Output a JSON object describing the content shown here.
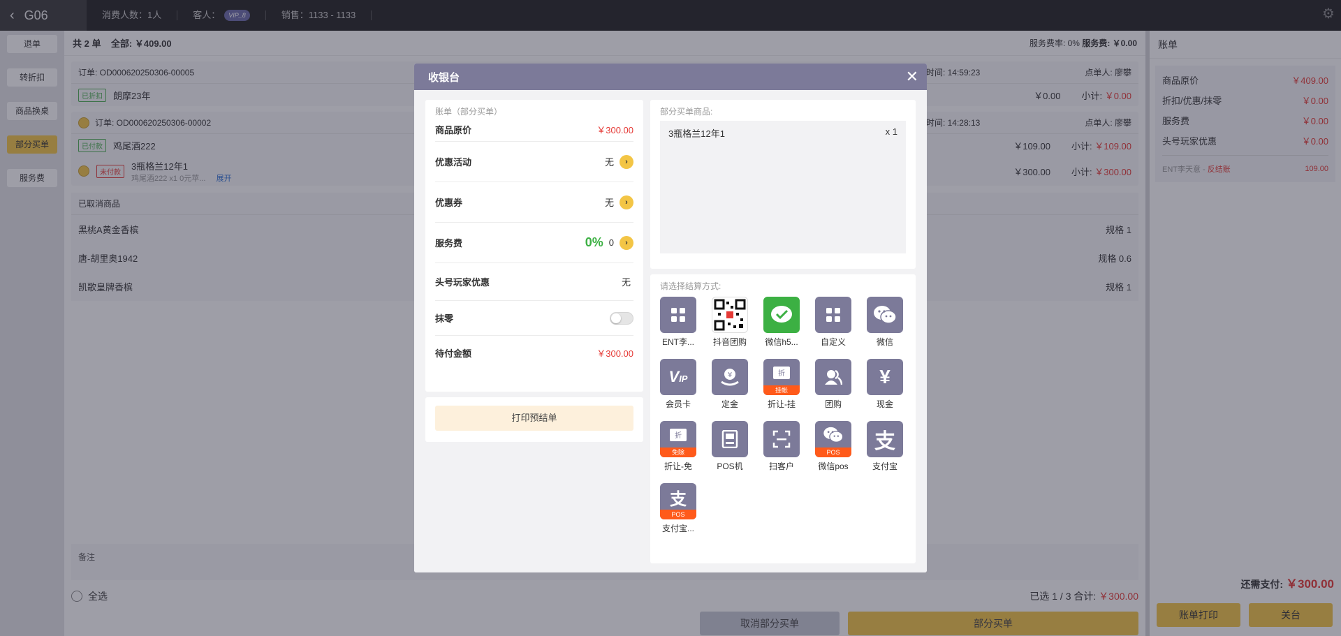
{
  "topbar": {
    "room": "G06",
    "consumers": "消费人数：1人",
    "guest_label": "客人：",
    "vip": "VIP_8",
    "sales": "销售：1133 - 1133"
  },
  "leftnav": [
    {
      "label": "退单",
      "active": false
    },
    {
      "label": "转折扣",
      "active": false
    },
    {
      "label": "商品换桌",
      "active": false
    },
    {
      "label": "部分买单",
      "active": true
    },
    {
      "label": "服务费",
      "active": false
    }
  ],
  "main": {
    "count": "共 2 单",
    "total": "全部: ￥409.00",
    "service_rate_label": "服务费率: 0%",
    "service_fee_label": "服务费: ￥0.00",
    "orders": [
      {
        "id": "订单: OD000620250306-00005",
        "time": "时间: 14:59:23",
        "orderer": "点单人: 廖攀",
        "items": [
          {
            "tag": "已折扣",
            "name": "朗摩23年",
            "price": "￥0.00",
            "subtotal_label": "小计:",
            "subtotal": "￥0.00"
          }
        ]
      },
      {
        "id": "订单: OD000620250306-00002",
        "time": "时间: 14:28:13",
        "orderer": "点单人: 廖攀",
        "items": [
          {
            "tag": "已付款",
            "name": "鸡尾酒222",
            "price": "￥109.00",
            "subtotal_label": "小计:",
            "subtotal": "￥109.00"
          },
          {
            "tag": "未付款",
            "name": "3瓶格兰12年1",
            "sub": "鸡尾酒222 x1   0元苹...",
            "expand": "展开",
            "price": "￥300.00",
            "subtotal_label": "小计:",
            "subtotal": "￥300.00"
          }
        ]
      }
    ],
    "cancelled_title": "已取消商品",
    "cancelled": [
      {
        "name": "黑桃A黄金香槟",
        "spec": "规格 1"
      },
      {
        "name": "唐-胡里奥1942",
        "spec": "规格 0.6"
      },
      {
        "name": "凯歌皇牌香槟",
        "spec": "规格 1"
      }
    ],
    "remark_label": "备注",
    "select_all": "全选",
    "selected_summary": "已选 1 / 3  合计:",
    "selected_total": "￥300.00",
    "cancel_partial": "取消部分买单",
    "partial_pay": "部分买单"
  },
  "bill_panel": {
    "title": "账单",
    "rows": [
      {
        "label": "商品原价",
        "value": "￥409.00"
      },
      {
        "label": "折扣/优惠/抹零",
        "value": "￥0.00"
      },
      {
        "label": "服务费",
        "value": "￥0.00"
      },
      {
        "label": "头号玩家优惠",
        "value": "￥0.00"
      }
    ],
    "ent_label": "ENT李天意 -",
    "ent_status": "反结账",
    "ent_value": "109.00",
    "need_label": "还需支付:",
    "need_value": "￥300.00",
    "print_btn": "账单打印",
    "close_btn": "关台"
  },
  "modal": {
    "title": "收银台",
    "close": "✕",
    "bill_caption": "账单（部分买单）",
    "original_label": "商品原价",
    "original_value": "￥300.00",
    "promo_label": "优惠活动",
    "promo_value": "无",
    "coupon_label": "优惠券",
    "coupon_value": "无",
    "service_label": "服务费",
    "service_pct": "0%",
    "service_value": "0",
    "player_label": "头号玩家优惠",
    "player_value": "无",
    "round_label": "抹零",
    "due_label": "待付金额",
    "due_value": "￥300.00",
    "print_pre": "打印预结单",
    "items_caption": "部分买单商品:",
    "item_name": "3瓶格兰12年1",
    "item_qty": "x 1",
    "pay_caption": "请选择结算方式:",
    "methods": [
      {
        "label": "ENT李...",
        "icon": "grid-icon"
      },
      {
        "label": "抖音团购",
        "icon": "qr-code-icon"
      },
      {
        "label": "微信h5...",
        "icon": "wechat-icon"
      },
      {
        "label": "自定义",
        "icon": "grid-icon"
      },
      {
        "label": "微信",
        "icon": "wechat-icon"
      },
      {
        "label": "会员卡",
        "icon": "vip-card-icon"
      },
      {
        "label": "定金",
        "icon": "deposit-icon"
      },
      {
        "label": "折让-挂",
        "icon": "discount-ticket-icon",
        "ribbon": "挂帐"
      },
      {
        "label": "团购",
        "icon": "group-icon"
      },
      {
        "label": "现金",
        "icon": "yuan-icon"
      },
      {
        "label": "折让-免",
        "icon": "discount-ticket-icon",
        "ribbon": "免除"
      },
      {
        "label": "POS机",
        "icon": "pos-terminal-icon"
      },
      {
        "label": "扫客户",
        "icon": "scan-icon"
      },
      {
        "label": "微信pos",
        "icon": "wechat-icon",
        "ribbon": "POS"
      },
      {
        "label": "支付宝",
        "icon": "alipay-icon"
      },
      {
        "label": "支付宝...",
        "icon": "alipay-icon",
        "ribbon": "POS"
      }
    ]
  }
}
